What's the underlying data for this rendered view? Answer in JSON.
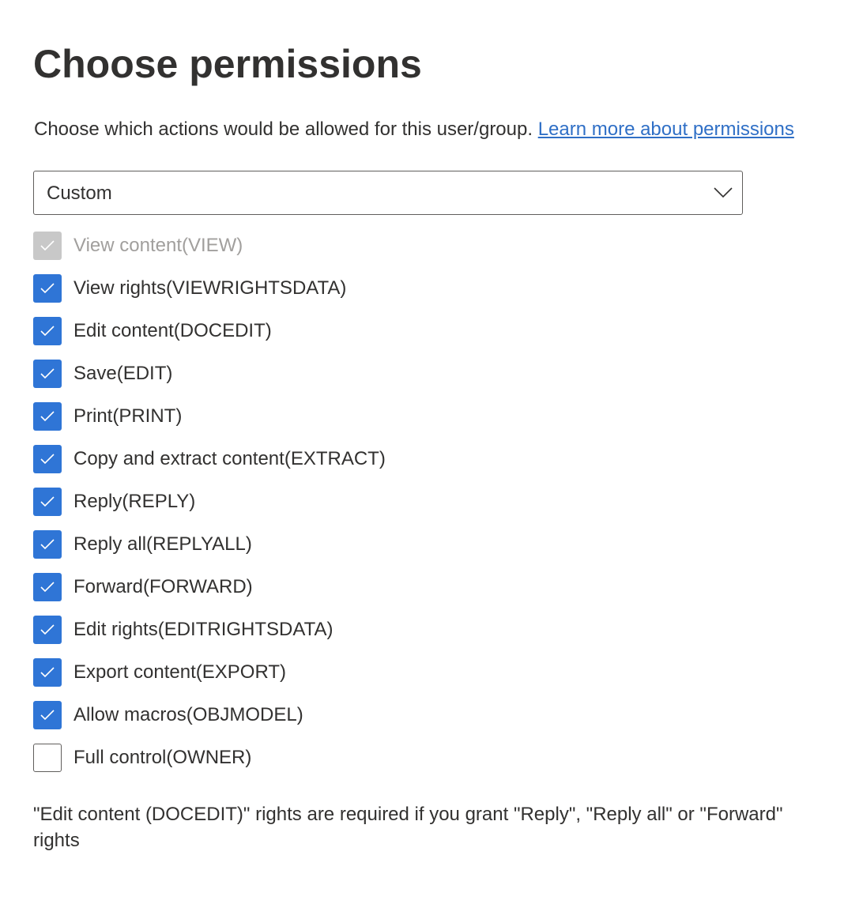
{
  "title": "Choose permissions",
  "subtitle": "Choose which actions would be allowed for this user/group. ",
  "learn_more_link": "Learn more about permissions",
  "dropdown": {
    "selected": "Custom",
    "icon": "chevron-down-icon"
  },
  "colors": {
    "accent": "#2f75d6",
    "link": "#2f6fc6",
    "disabled": "#c8c8c8"
  },
  "permissions": [
    {
      "label": "View content(VIEW)",
      "checked": true,
      "disabled": true
    },
    {
      "label": "View rights(VIEWRIGHTSDATA)",
      "checked": true,
      "disabled": false
    },
    {
      "label": "Edit content(DOCEDIT)",
      "checked": true,
      "disabled": false
    },
    {
      "label": "Save(EDIT)",
      "checked": true,
      "disabled": false
    },
    {
      "label": "Print(PRINT)",
      "checked": true,
      "disabled": false
    },
    {
      "label": "Copy and extract content(EXTRACT)",
      "checked": true,
      "disabled": false
    },
    {
      "label": "Reply(REPLY)",
      "checked": true,
      "disabled": false
    },
    {
      "label": "Reply all(REPLYALL)",
      "checked": true,
      "disabled": false
    },
    {
      "label": "Forward(FORWARD)",
      "checked": true,
      "disabled": false
    },
    {
      "label": "Edit rights(EDITRIGHTSDATA)",
      "checked": true,
      "disabled": false
    },
    {
      "label": "Export content(EXPORT)",
      "checked": true,
      "disabled": false
    },
    {
      "label": "Allow macros(OBJMODEL)",
      "checked": true,
      "disabled": false
    },
    {
      "label": "Full control(OWNER)",
      "checked": false,
      "disabled": false
    }
  ],
  "note": "\"Edit content (DOCEDIT)\" rights are required if you grant \"Reply\", \"Reply all\" or \"Forward\" rights"
}
